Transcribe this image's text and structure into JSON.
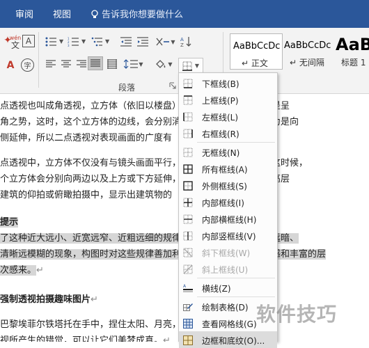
{
  "tabs": {
    "review": "审阅",
    "view": "视图",
    "tell_me": "告诉我你想要做什么"
  },
  "ribbon": {
    "wen": "wén",
    "wen_char": "文",
    "border_A": "A",
    "char_A": "A",
    "char_zi": "字",
    "group_label": "段落"
  },
  "styles": [
    {
      "sample": "AaBbCcDc",
      "name": "正文",
      "prefix": "↵"
    },
    {
      "sample": "AaBbCcDc",
      "name": "无间隔",
      "prefix": "↵"
    },
    {
      "sample": "AaB",
      "name": "标题 1",
      "prefix": ""
    }
  ],
  "document": {
    "lines": [
      "点透视也叫成角透视，立方体（依旧以楼盘）不与镜头画面平行，都是呈",
      "角之势，这时，这个立方体的边线，会分别消失在两个消失点上。因为是向",
      "侧延伸，所以二点透视对表现画面的广度有",
      "点透视中，立方体不仅没有与镜头画面平行，与之垂直的面也没有，这时候，",
      "个立方体会分别向两边以及上方或下方延伸，三点透视经常被用在超高层",
      "建筑的仰拍或俯瞰拍摄中，显示出建筑物的",
      "提示",
      "了这种近大远小、近宽远窄、近粗远细的规律。近高远低，以及近明远暗、",
      "清晰远模糊的现象，构图时对这些规律善加利用，会让照片有着立体感和丰富的层",
      "次感来。",
      "强制透视拍摄趣味图片",
      "巴黎埃菲尔铁塔托在手中，捏住太阳、月亮，",
      "视所产生的错觉，可以让它们美梦成真。"
    ]
  },
  "border_menu": {
    "items": [
      {
        "label": "下框线(B)",
        "icon": "bottom-border-icon",
        "disabled": false
      },
      {
        "label": "上框线(P)",
        "icon": "top-border-icon",
        "disabled": false
      },
      {
        "label": "左框线(L)",
        "icon": "left-border-icon",
        "disabled": false
      },
      {
        "label": "右框线(R)",
        "icon": "right-border-icon",
        "disabled": false
      },
      {
        "label": "无框线(N)",
        "icon": "no-border-icon",
        "disabled": false
      },
      {
        "label": "所有框线(A)",
        "icon": "all-borders-icon",
        "disabled": false
      },
      {
        "label": "外侧框线(S)",
        "icon": "outside-borders-icon",
        "disabled": false
      },
      {
        "label": "内部框线(I)",
        "icon": "inside-borders-icon",
        "disabled": false
      },
      {
        "label": "内部横框线(H)",
        "icon": "inside-horizontal-border-icon",
        "disabled": false
      },
      {
        "label": "内部竖框线(V)",
        "icon": "inside-vertical-border-icon",
        "disabled": false
      },
      {
        "label": "斜下框线(W)",
        "icon": "diagonal-down-border-icon",
        "disabled": true
      },
      {
        "label": "斜上框线(U)",
        "icon": "diagonal-up-border-icon",
        "disabled": true
      },
      {
        "label": "横线(Z)",
        "icon": "horizontal-line-icon",
        "disabled": false
      },
      {
        "label": "绘制表格(D)",
        "icon": "draw-table-icon",
        "disabled": false
      },
      {
        "label": "查看网格线(G)",
        "icon": "view-gridlines-icon",
        "disabled": false
      },
      {
        "label": "边框和底纹(O)...",
        "icon": "borders-shading-icon",
        "disabled": false
      }
    ]
  },
  "watermark": "软件技巧"
}
